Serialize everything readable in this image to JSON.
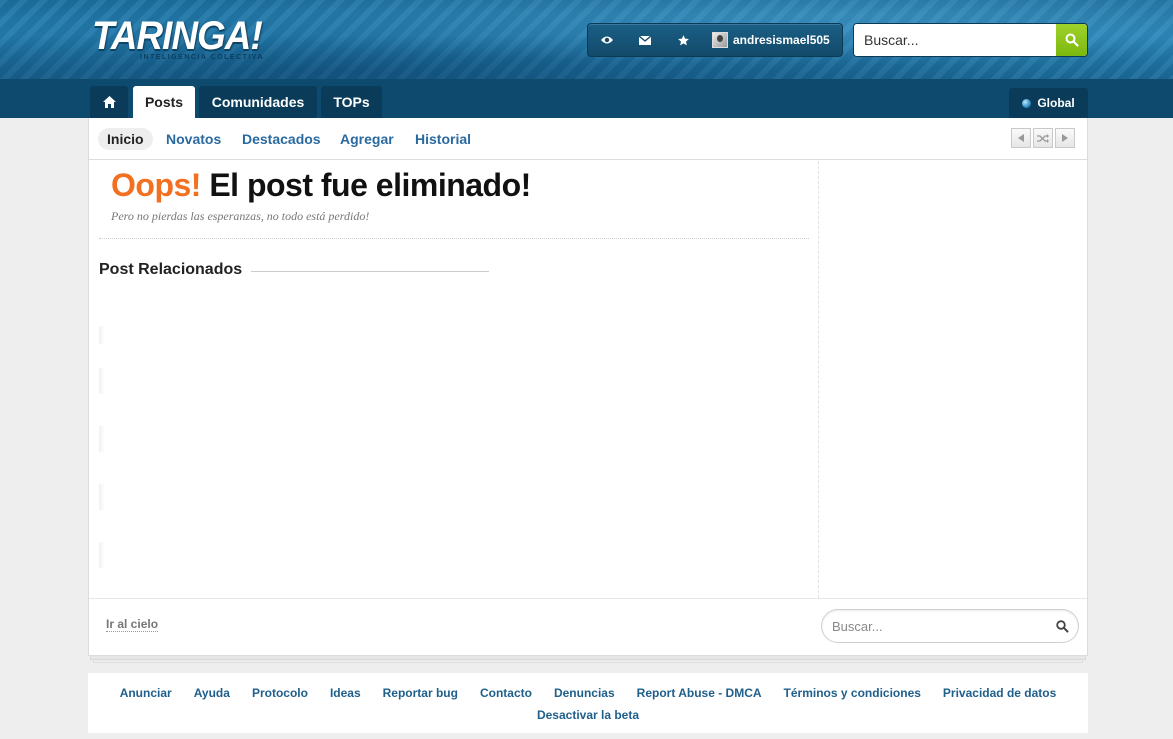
{
  "header": {
    "logo_text": "TARINGA!",
    "logo_tagline": "INTELIGENCIA COLECTIVA",
    "username": "andresismael505",
    "search_placeholder": "Buscar...",
    "icons": [
      "eye-icon",
      "mail-icon",
      "star-icon",
      "search-icon"
    ]
  },
  "nav": {
    "tabs": [
      {
        "label": "",
        "icon": "home-icon"
      },
      {
        "label": "Posts",
        "active": true
      },
      {
        "label": "Comunidades"
      },
      {
        "label": "TOPs"
      }
    ],
    "global_label": "Global"
  },
  "subnav": {
    "items": [
      {
        "label": "Inicio",
        "active": true
      },
      {
        "label": "Novatos"
      },
      {
        "label": "Destacados"
      },
      {
        "label": "Agregar"
      },
      {
        "label": "Historial"
      }
    ]
  },
  "main": {
    "oops": "Oops!",
    "title": "El post fue eliminado!",
    "subtitle": "Pero no pierdas las esperanzas, no todo está perdido!",
    "related_heading": "Post Relacionados"
  },
  "bottom": {
    "back_to_top": "Ir al cielo",
    "search_placeholder": "Buscar..."
  },
  "footer": {
    "links": [
      "Anunciar",
      "Ayuda",
      "Protocolo",
      "Ideas",
      "Reportar bug",
      "Contacto",
      "Denuncias",
      "Report Abuse - DMCA",
      "Términos y condiciones",
      "Privacidad de datos"
    ],
    "beta_link": "Desactivar la beta"
  },
  "colors": {
    "brand_blue": "#0e4a6e",
    "link_blue": "#2a6aa0",
    "oops_orange": "#f37021",
    "search_green": "#8cc51a"
  }
}
